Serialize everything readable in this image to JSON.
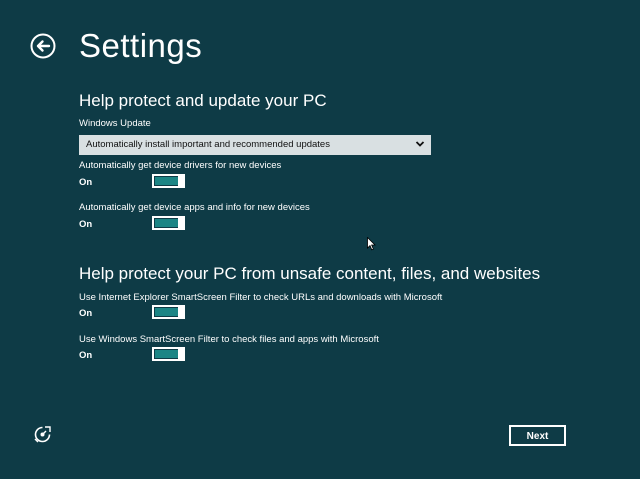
{
  "header": {
    "title": "Settings",
    "back_icon": "back-arrow-icon"
  },
  "section_update": {
    "title": "Help protect and update your PC",
    "windows_update_label": "Windows Update",
    "windows_update_selected": "Automatically install important and recommended updates",
    "device_drivers_label": "Automatically get device drivers for new devices",
    "device_drivers_state": "On",
    "device_apps_label": "Automatically get device apps and info for new devices",
    "device_apps_state": "On"
  },
  "section_safety": {
    "title": "Help protect your PC from unsafe content, files, and websites",
    "ie_smartscreen_label": "Use Internet Explorer SmartScreen Filter to check URLs and downloads with Microsoft",
    "ie_smartscreen_state": "On",
    "win_smartscreen_label": "Use Windows SmartScreen Filter to check files and apps with Microsoft",
    "win_smartscreen_state": "On"
  },
  "footer": {
    "ease_of_access_icon": "ease-of-access-icon",
    "next_label": "Next"
  },
  "colors": {
    "background": "#0e3b46",
    "toggle_fill": "#1c8585",
    "dropdown_bg": "#d9e0e2",
    "text": "#ffffff"
  }
}
